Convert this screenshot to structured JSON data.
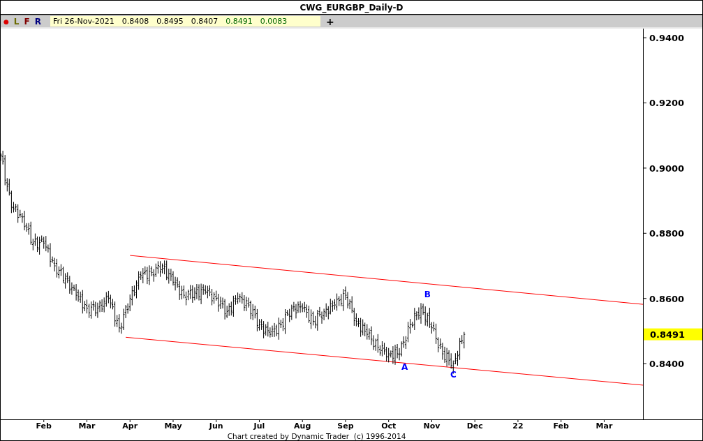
{
  "window": {
    "title": "CWG_EURGBP_Daily-D"
  },
  "toolbar": {
    "buttons": [
      {
        "label": "●",
        "color": "#dd0000"
      },
      {
        "label": "L",
        "color": "#6b6b00"
      },
      {
        "label": "F",
        "color": "#800000"
      },
      {
        "label": "R",
        "color": "#000080"
      }
    ],
    "quote": [
      {
        "text": "Fri 26-Nov-2021",
        "color": "#000000"
      },
      {
        "text": "0.8408",
        "color": "#000000"
      },
      {
        "text": "0.8495",
        "color": "#000000"
      },
      {
        "text": "0.8407",
        "color": "#000000"
      },
      {
        "text": "0.8491",
        "color": "#006600"
      },
      {
        "text": "0.0083",
        "color": "#006600"
      }
    ],
    "add_button": "+"
  },
  "chart": {
    "price_labels": [
      "0.9400",
      "0.9200",
      "0.9000",
      "0.8800",
      "0.8600",
      "0.8400"
    ],
    "date_labels": [
      "Feb",
      "Mar",
      "Apr",
      "May",
      "Jun",
      "Jul",
      "Aug",
      "Sep",
      "Oct",
      "Nov",
      "Dec",
      "22",
      "Feb",
      "Mar"
    ],
    "wave_labels": [
      "A",
      "B",
      "C"
    ],
    "price_tag": "0.8491",
    "footer": "Chart created by Dynamic Trader  (c) 1996-2014"
  }
}
